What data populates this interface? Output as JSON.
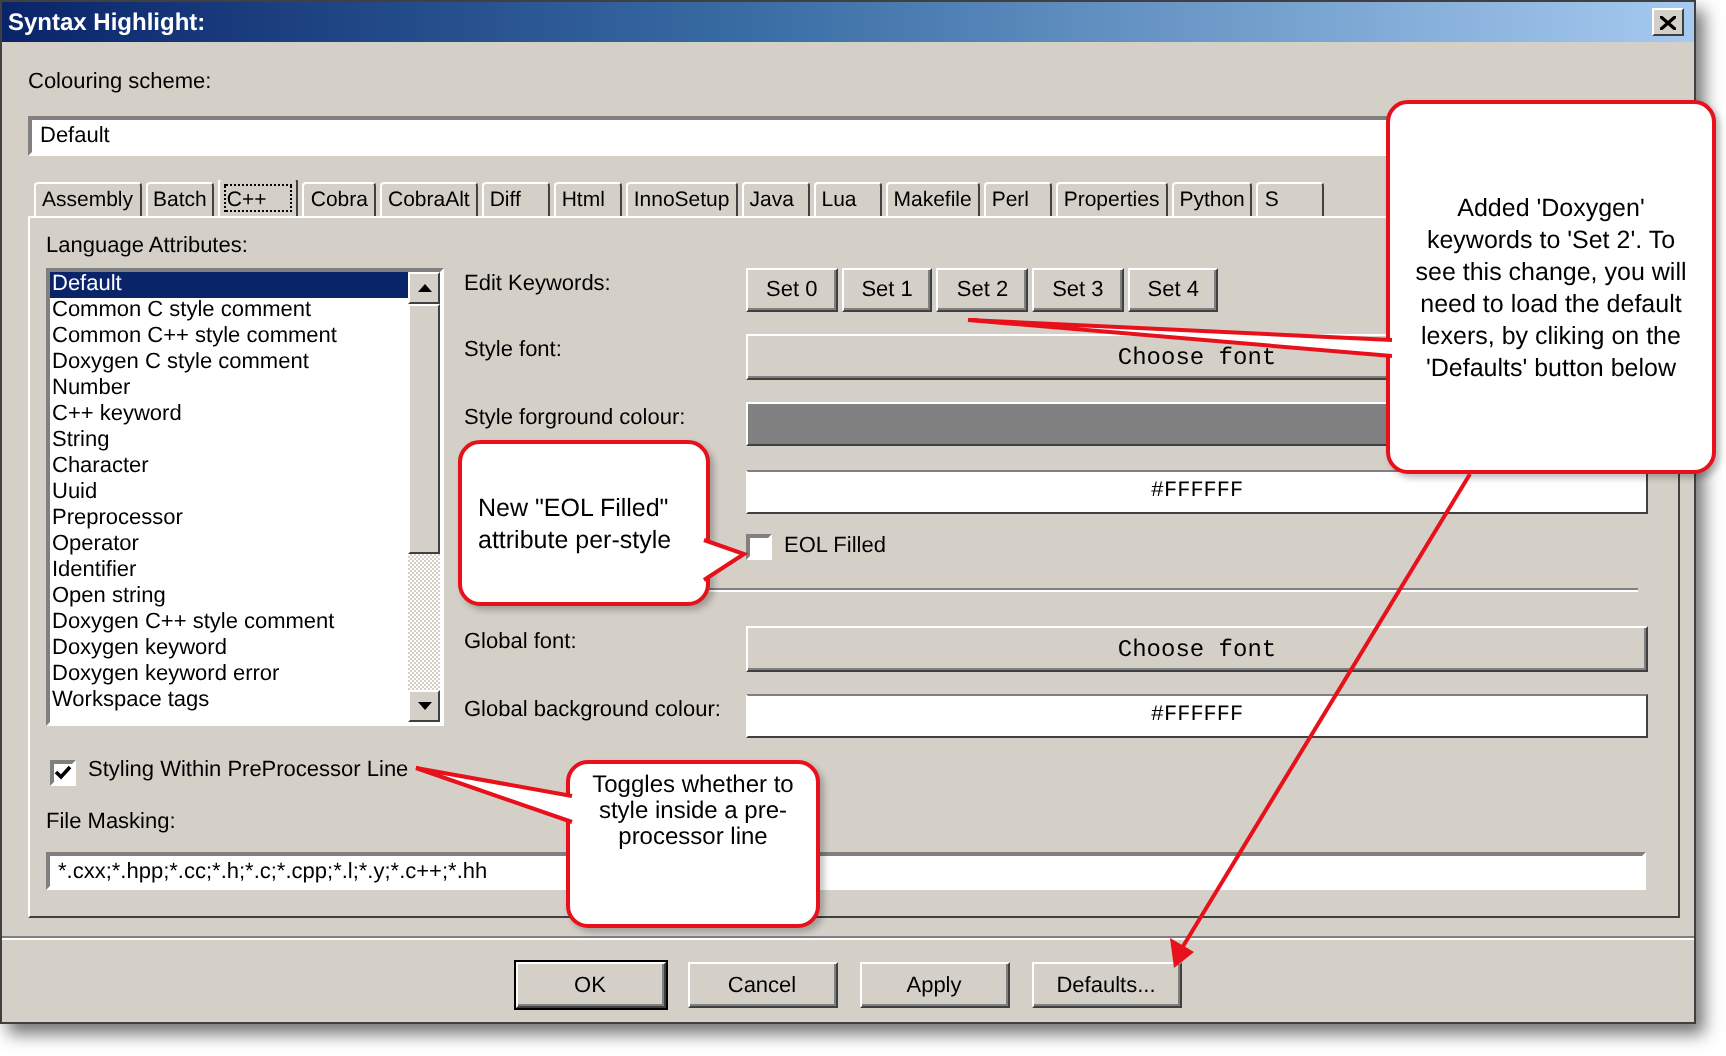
{
  "window": {
    "title": "Syntax Highlight:"
  },
  "colouring_scheme": {
    "label": "Colouring scheme:",
    "value": "Default"
  },
  "tabs": [
    {
      "label": "Assembly",
      "selected": false
    },
    {
      "label": "Batch",
      "selected": false
    },
    {
      "label": "C++",
      "selected": true
    },
    {
      "label": "Cobra",
      "selected": false
    },
    {
      "label": "CobraAlt",
      "selected": false
    },
    {
      "label": "Diff",
      "selected": false
    },
    {
      "label": "Html",
      "selected": false
    },
    {
      "label": "InnoSetup",
      "selected": false
    },
    {
      "label": "Java",
      "selected": false
    },
    {
      "label": "Lua",
      "selected": false
    },
    {
      "label": "Makefile",
      "selected": false
    },
    {
      "label": "Perl",
      "selected": false
    },
    {
      "label": "Properties",
      "selected": false
    },
    {
      "label": "Python",
      "selected": false
    },
    {
      "label": "S",
      "selected": false
    }
  ],
  "language_attributes": {
    "label": "Language Attributes:",
    "items": [
      {
        "label": "Default",
        "selected": true
      },
      {
        "label": "Common C style comment",
        "selected": false
      },
      {
        "label": "Common C++ style comment",
        "selected": false
      },
      {
        "label": "Doxygen C style comment",
        "selected": false
      },
      {
        "label": "Number",
        "selected": false
      },
      {
        "label": "C++ keyword",
        "selected": false
      },
      {
        "label": "String",
        "selected": false
      },
      {
        "label": "Character",
        "selected": false
      },
      {
        "label": "Uuid",
        "selected": false
      },
      {
        "label": "Preprocessor",
        "selected": false
      },
      {
        "label": "Operator",
        "selected": false
      },
      {
        "label": "Identifier",
        "selected": false
      },
      {
        "label": "Open string",
        "selected": false
      },
      {
        "label": "Doxygen C++ style comment",
        "selected": false
      },
      {
        "label": "Doxygen keyword",
        "selected": false
      },
      {
        "label": "Doxygen keyword error",
        "selected": false
      },
      {
        "label": "Workspace tags",
        "selected": false
      }
    ]
  },
  "edit_keywords": {
    "label": "Edit Keywords:",
    "buttons": [
      "Set 0",
      "Set 1",
      "Set 2",
      "Set 3",
      "Set 4"
    ]
  },
  "style_font": {
    "label": "Style font:",
    "button": "Choose font"
  },
  "style_foreground": {
    "label": "Style forground colour:",
    "color": "#808080"
  },
  "style_background": {
    "value": "#FFFFFF"
  },
  "eol_filled": {
    "label": "EOL Filled",
    "checked": false
  },
  "global_font": {
    "label": "Global font:",
    "button": "Choose font"
  },
  "global_background": {
    "label": "Global background colour:",
    "value": "#FFFFFF"
  },
  "styling_within_preprocessor": {
    "label": "Styling Within PreProcessor Line",
    "checked": true
  },
  "file_masking": {
    "label": "File Masking:",
    "value": "*.cxx;*.hpp;*.cc;*.h;*.c;*.cpp;*.l;*.y;*.c++;*.hh"
  },
  "buttons": [
    {
      "label": "OK",
      "default": true
    },
    {
      "label": "Cancel",
      "default": false
    },
    {
      "label": "Apply",
      "default": false
    },
    {
      "label": "Defaults...",
      "default": false
    }
  ],
  "callouts": [
    {
      "text": "Added 'Doxygen' keywords to 'Set 2'. To see this change, you will need to load the default lexers, by cliking on the 'Defaults' button below"
    },
    {
      "text": "New \"EOL Filled\" attribute per-style"
    },
    {
      "text": "Toggles whether to style inside a pre-processor line"
    }
  ]
}
